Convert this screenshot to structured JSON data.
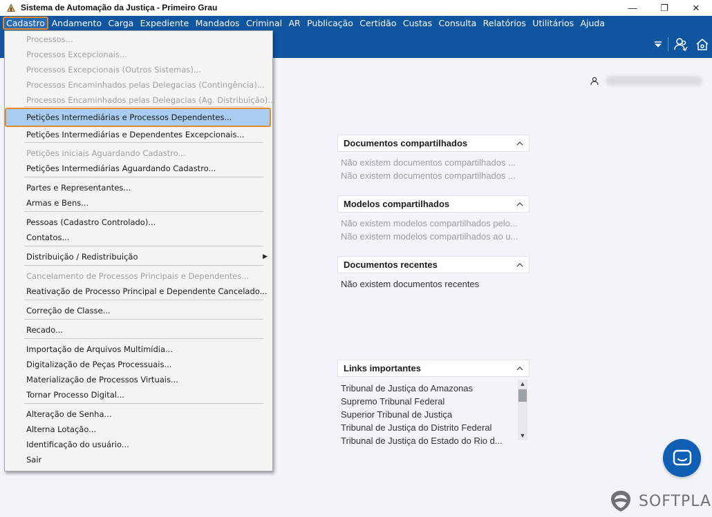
{
  "window": {
    "title": "Sistema de Automação da Justiça - Primeiro Grau",
    "minimize": "—",
    "restore": "❐",
    "close": "✕"
  },
  "menubar": {
    "items": [
      "Cadastro",
      "Andamento",
      "Carga",
      "Expediente",
      "Mandados",
      "Criminal",
      "AR",
      "Publicação",
      "Certidão",
      "Custas",
      "Consulta",
      "Relatórios",
      "Utilitários",
      "Ajuda"
    ],
    "active": "Cadastro"
  },
  "cadastro_menu": {
    "items": [
      {
        "label": "Processos...",
        "enabled": false
      },
      {
        "label": "Processos Excepcionais...",
        "enabled": false
      },
      {
        "label": "Processos Excepcionais (Outros Sistemas)...",
        "enabled": false
      },
      {
        "label": "Processos Encaminhados pelas Delegacias (Contingência)...",
        "enabled": false
      },
      {
        "label": "Processos Encaminhados pelas Delegacias (Ag. Distribuição)...",
        "enabled": false
      },
      {
        "label": "Petições Intermediárias e Processos Dependentes...",
        "enabled": true,
        "highlighted": true
      },
      {
        "label": "Petições Intermediárias e Dependentes Excepcionais...",
        "enabled": true
      },
      {
        "label": "Petições Iniciais Aguardando Cadastro...",
        "enabled": false
      },
      {
        "label": "Petições Intermediárias Aguardando Cadastro...",
        "enabled": true
      },
      {
        "label": "Partes e Representantes...",
        "enabled": true
      },
      {
        "label": "Armas e Bens...",
        "enabled": true
      },
      {
        "label": "Pessoas (Cadastro Controlado)...",
        "enabled": true
      },
      {
        "label": "Contatos...",
        "enabled": true
      },
      {
        "label": "Distribuição / Redistribuição",
        "enabled": true,
        "submenu": true
      },
      {
        "label": "Cancelamento de Processos Principais e Dependentes...",
        "enabled": false
      },
      {
        "label": "Reativação de Processo Principal e Dependente Cancelado...",
        "enabled": true
      },
      {
        "label": "Correção de Classe...",
        "enabled": true
      },
      {
        "label": "Recado...",
        "enabled": true
      },
      {
        "label": "Importação de Arquivos Multimídia...",
        "enabled": true
      },
      {
        "label": "Digitalização de Peças Processuais...",
        "enabled": true
      },
      {
        "label": "Materialização de Processos Virtuais...",
        "enabled": true
      },
      {
        "label": "Tornar Processo Digital...",
        "enabled": true
      },
      {
        "label": "Alteração de Senha...",
        "enabled": true
      },
      {
        "label": "Alterna Lotação...",
        "enabled": true
      },
      {
        "label": "Identificação do usuário...",
        "enabled": true
      },
      {
        "label": "Sair",
        "enabled": true
      }
    ],
    "submenu_arrow": "▶"
  },
  "panels": {
    "shared_docs": {
      "title": "Documentos compartilhados",
      "rows": [
        "Não existem documentos compartilhados ...",
        "Não existem documentos compartilhados ..."
      ]
    },
    "shared_models": {
      "title": "Modelos compartilhados",
      "rows": [
        "Não existem modelos compartilhados pelo...",
        "Não existem modelos compartilhados ao u..."
      ]
    },
    "recent_docs": {
      "title": "Documentos recentes",
      "rows": [
        "Não existem documentos recentes"
      ]
    },
    "links": {
      "title": "Links importantes",
      "rows": [
        "Tribunal de Justiça do Amazonas",
        "Supremo Tribunal Federal",
        "Superior Tribunal de Justiça",
        "Tribunal de Justiça do Distrito Federal",
        "Tribunal de Justiça do Estado do Rio d..."
      ]
    }
  },
  "brand": {
    "name": "SOFTPLAN"
  },
  "colors": {
    "accent": "#0f55a0",
    "highlight": "#a8cdf0",
    "focus_border": "#e6892a"
  },
  "icons": {
    "toolbar": [
      "filter-dropdown-icon",
      "users-icon",
      "home-icon"
    ],
    "user": "user-icon",
    "chat": "chat-icon"
  }
}
